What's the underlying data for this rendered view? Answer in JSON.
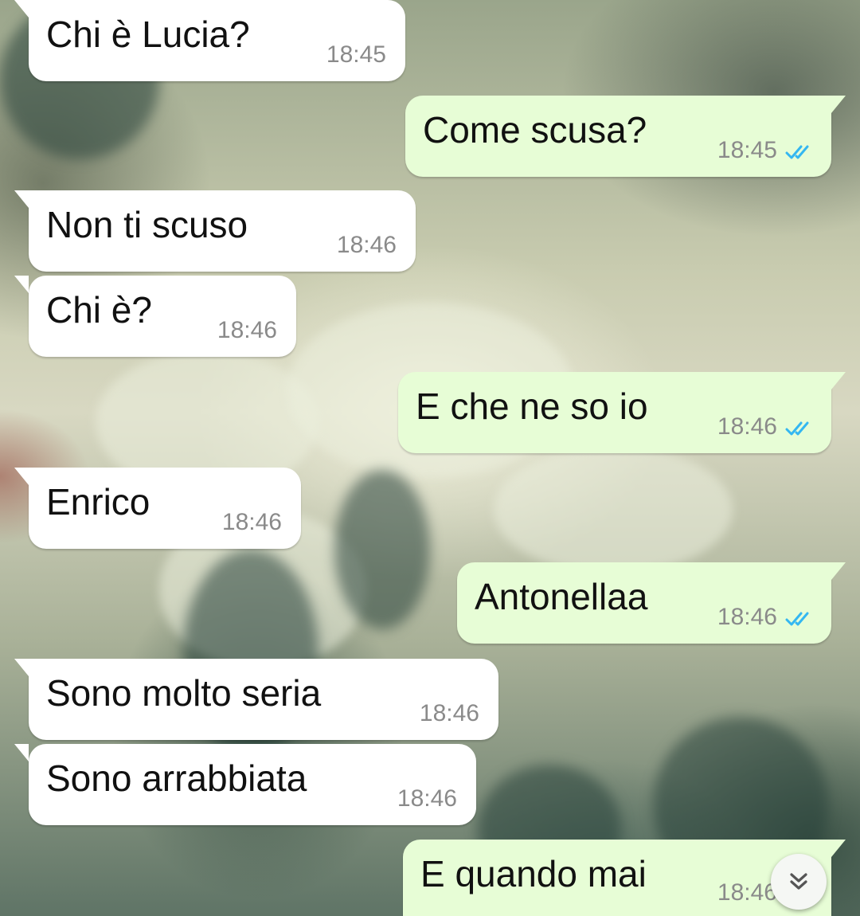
{
  "colors": {
    "incoming_bubble": "#ffffff",
    "outgoing_bubble": "#e7fdd6",
    "read_ticks": "#34b7f1",
    "timestamp": "#8a8a8a"
  },
  "messages": [
    {
      "direction": "in",
      "text": "Chi è Lucia?",
      "time": "18:45"
    },
    {
      "direction": "out",
      "text": "Come scusa?",
      "time": "18:45",
      "status": "read"
    },
    {
      "direction": "in",
      "text": "Non ti scuso",
      "time": "18:46"
    },
    {
      "direction": "in",
      "text": "Chi è?",
      "time": "18:46"
    },
    {
      "direction": "out",
      "text": "E che ne so io",
      "time": "18:46",
      "status": "read"
    },
    {
      "direction": "in",
      "text": "Enrico",
      "time": "18:46"
    },
    {
      "direction": "out",
      "text": "Antonellaa",
      "time": "18:46",
      "status": "read"
    },
    {
      "direction": "in",
      "text": "Sono molto seria",
      "time": "18:46"
    },
    {
      "direction": "in",
      "text": "Sono arrabbiata",
      "time": "18:46"
    },
    {
      "direction": "out",
      "text": "E quando mai",
      "time": "18:46",
      "status": "read"
    }
  ],
  "scroll_button": {
    "icon": "double-chevron-down-icon"
  }
}
